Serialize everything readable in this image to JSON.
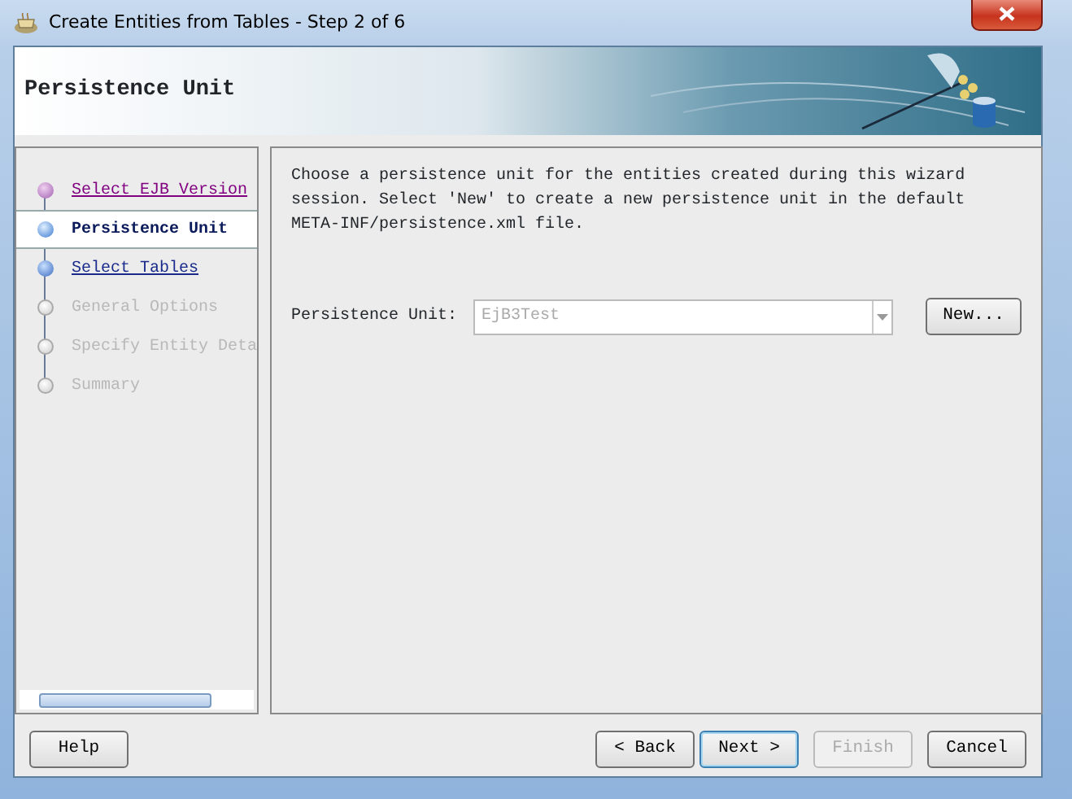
{
  "window": {
    "title": "Create Entities from Tables - Step 2 of 6"
  },
  "header": {
    "title": "Persistence Unit"
  },
  "steps": [
    {
      "label": "Select EJB Version",
      "kind": "visited",
      "selected": false
    },
    {
      "label": "Persistence Unit",
      "kind": "current",
      "selected": true
    },
    {
      "label": "Select Tables",
      "kind": "available",
      "selected": false
    },
    {
      "label": "General Options",
      "kind": "disabled",
      "selected": false
    },
    {
      "label": "Specify Entity Deta",
      "kind": "disabled",
      "selected": false
    },
    {
      "label": "Summary",
      "kind": "disabled",
      "selected": false
    }
  ],
  "content": {
    "description": "Choose a persistence unit for the entities created during this wizard session.  Select 'New' to create a new persistence unit in the default META-INF/persistence.xml file.",
    "field": {
      "label": "Persistence Unit:",
      "value": "EjB3Test",
      "disabled": true
    },
    "new_button": {
      "label": "New..."
    }
  },
  "buttons": [
    {
      "label": "Help",
      "kind": "left",
      "disabled": false,
      "focused": false
    },
    {
      "label": "< Back",
      "kind": "right",
      "disabled": false,
      "focused": false
    },
    {
      "label": "Next >",
      "kind": "right",
      "disabled": false,
      "focused": true
    },
    {
      "label": "Finish",
      "kind": "right",
      "disabled": true,
      "focused": false
    },
    {
      "label": "Cancel",
      "kind": "right",
      "disabled": false,
      "focused": false
    }
  ]
}
